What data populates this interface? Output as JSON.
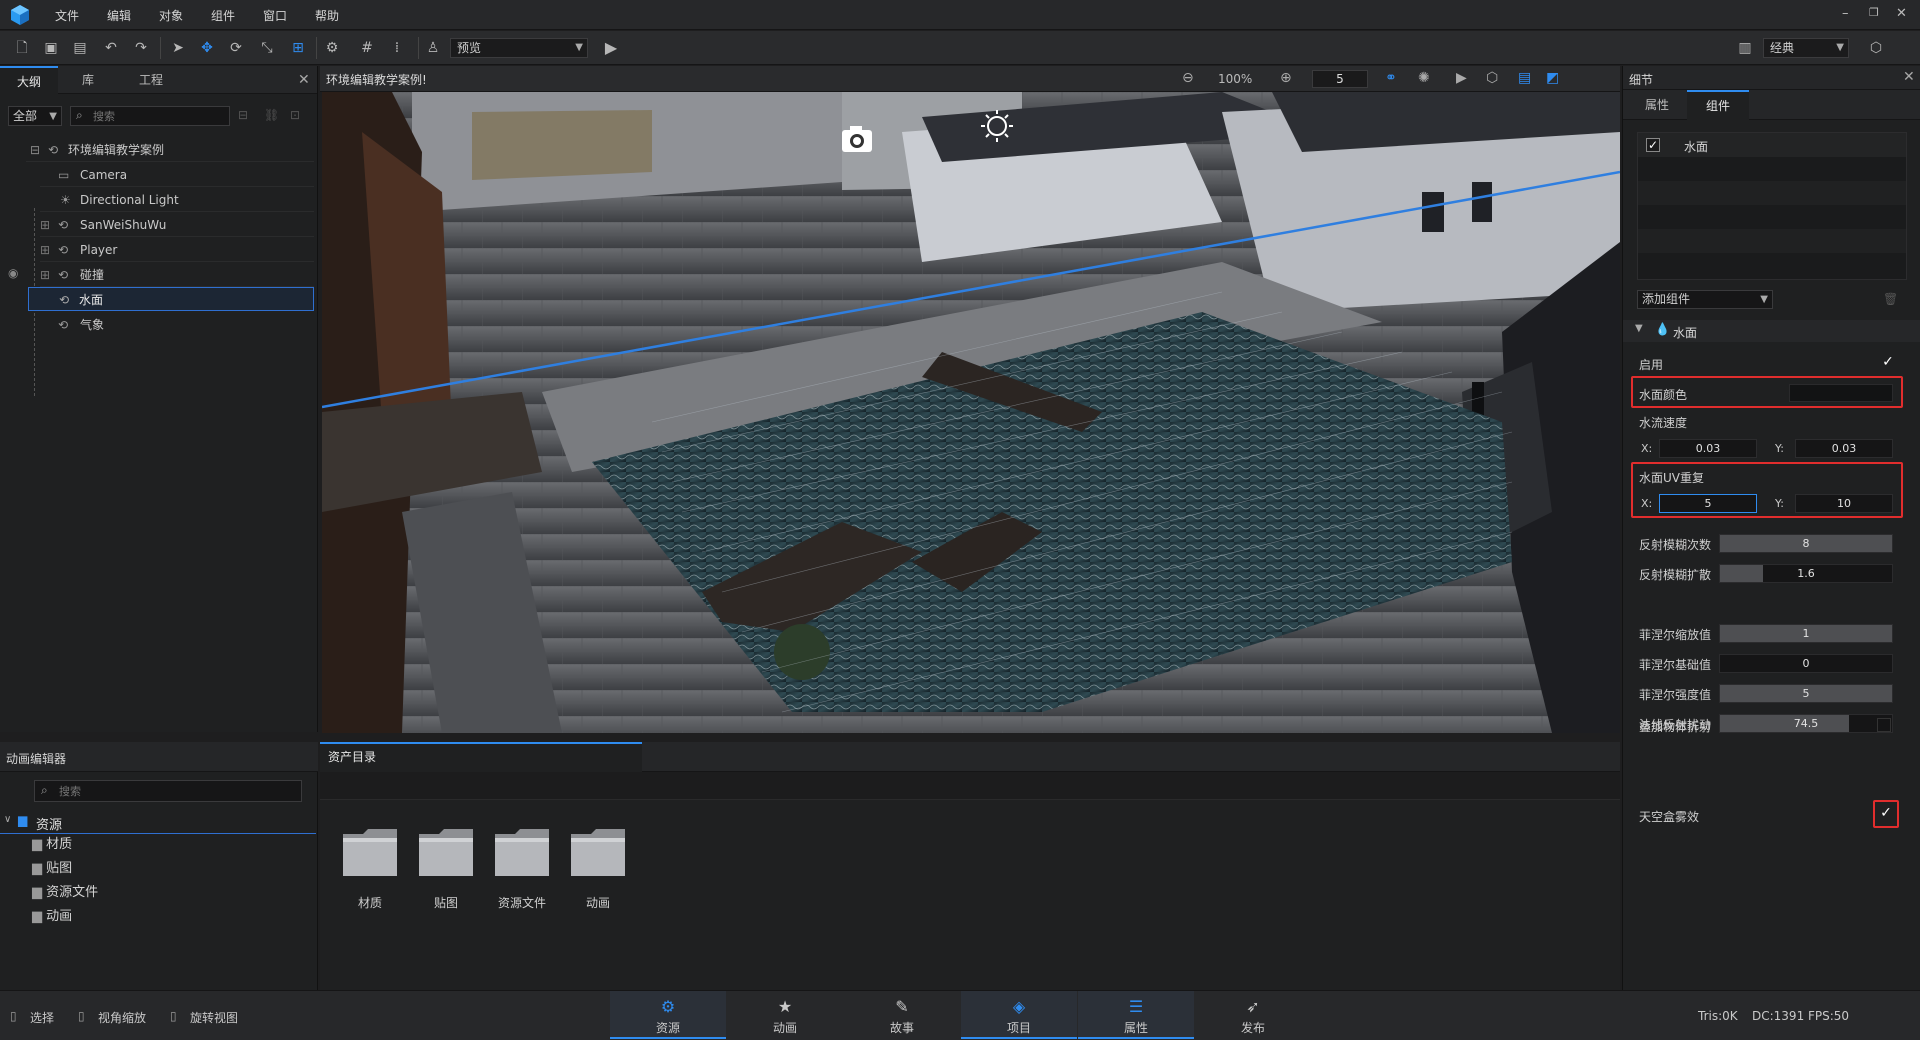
{
  "menubar": {
    "items": [
      "文件",
      "编辑",
      "对象",
      "组件",
      "窗口",
      "帮助"
    ]
  },
  "toolbar": {
    "preview_label": "预览",
    "layout_label": "经典"
  },
  "left_panel": {
    "tabs": [
      "大纲",
      "库",
      "工程"
    ],
    "filter_value": "全部",
    "search_placeholder": "搜索",
    "tree": [
      {
        "label": "环境编辑教学案例",
        "icon": "scene-icon"
      },
      {
        "label": "Camera",
        "icon": "camera-icon"
      },
      {
        "label": "Directional Light",
        "icon": "light-icon"
      },
      {
        "label": "SanWeiShuWu",
        "icon": "object-icon"
      },
      {
        "label": "Player",
        "icon": "object-icon"
      },
      {
        "label": "碰撞",
        "icon": "object-icon"
      },
      {
        "label": "水面",
        "icon": "object-icon"
      },
      {
        "label": "气象",
        "icon": "object-icon"
      }
    ]
  },
  "viewport": {
    "title": "环境编辑教学案例!",
    "zoom": "100%",
    "grid_value": "5"
  },
  "right_panel": {
    "title": "细节",
    "tabs": [
      "属性",
      "组件"
    ],
    "component_list": [
      "水面"
    ],
    "add_component_label": "添加组件",
    "section_title": "水面",
    "props": {
      "enable_label": "启用",
      "water_color_label": "水面颜色",
      "water_color": "#121314",
      "flow_speed_label": "水流速度",
      "flow_x": "0.03",
      "flow_y": "0.03",
      "uv_repeat_label": "水面UV重复",
      "uv_x": "5",
      "uv_y": "10",
      "x_label": "X:",
      "y_label": "Y:",
      "sliders": [
        {
          "label": "反射模糊次数",
          "value": "8",
          "fill": 1.0
        },
        {
          "label": "反射模糊扩散",
          "value": "1.6",
          "fill": 0.25
        },
        {
          "label": "菲涅尔缩放值",
          "value": "1",
          "fill": 1.0
        },
        {
          "label": "菲涅尔基础值",
          "value": "0",
          "fill": 0.0
        },
        {
          "label": "菲涅尔强度值",
          "value": "5",
          "fill": 1.0
        },
        {
          "label": "法线反射扰动",
          "value": "74.5",
          "fill": 0.75
        }
      ],
      "overlay_refraction_label": "叠加物体折射",
      "skybox_fog_label": "天空盒雾效"
    }
  },
  "anim_panel": {
    "title": "动画编辑器",
    "search_placeholder": "搜索",
    "root": "资源",
    "children": [
      "材质",
      "贴图",
      "资源文件",
      "动画"
    ]
  },
  "asset_panel": {
    "tab": "资产目录",
    "folders": [
      "材质",
      "贴图",
      "资源文件",
      "动画"
    ]
  },
  "statusbar": {
    "select": "选择",
    "zoom_view": "视角缩放",
    "rotate_view": "旋转视图",
    "tabs": [
      "资源",
      "动画",
      "故事",
      "项目",
      "属性",
      "发布"
    ],
    "tris": "Tris:0K",
    "dc": "DC:1391",
    "fps": "FPS:50"
  },
  "colors": {
    "accent": "#2f8cf0",
    "highlight": "#e12d2d"
  }
}
